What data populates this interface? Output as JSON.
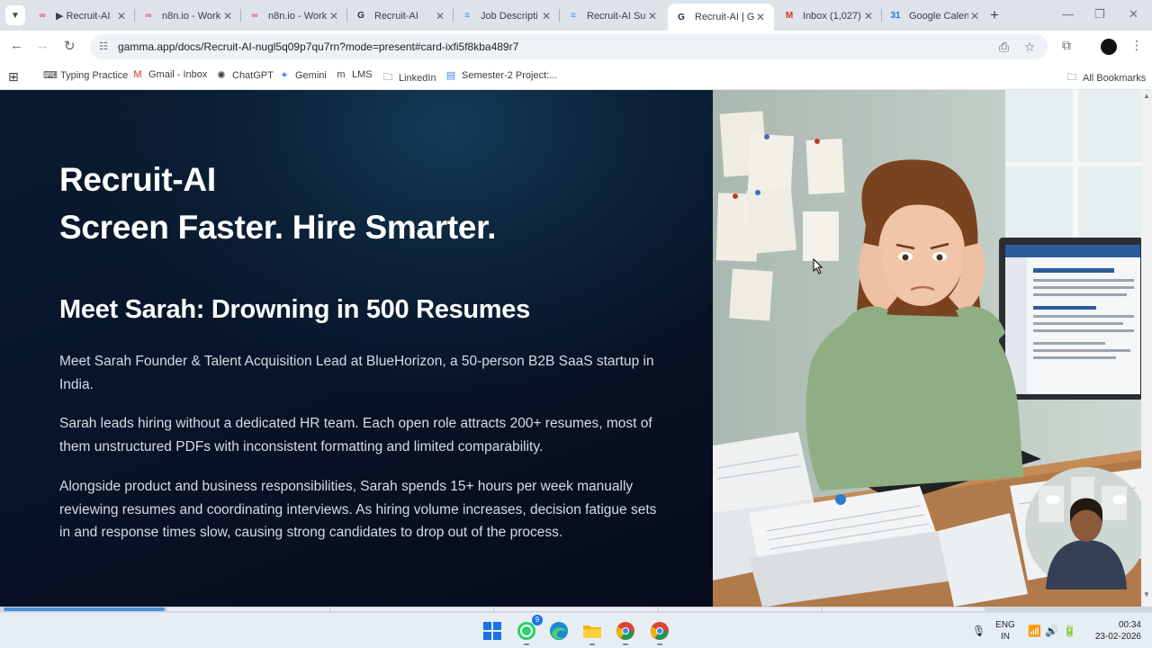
{
  "browser": {
    "tabs": [
      {
        "title": "▶ Recruit-AI",
        "favicon": "n8n-logo-icon",
        "fav_color": "#ea4b71",
        "active": false
      },
      {
        "title": "n8n.io - Work",
        "favicon": "n8n-logo-icon",
        "fav_color": "#ea4b71",
        "active": false
      },
      {
        "title": "n8n.io - Work",
        "favicon": "n8n-logo-icon",
        "fav_color": "#ea4b71",
        "active": false
      },
      {
        "title": "Recruit-AI",
        "favicon": "gamma-logo-icon",
        "fav_color": "#1f2a44",
        "active": false
      },
      {
        "title": "Job Descripti",
        "favicon": "google-docs-icon",
        "fav_color": "#4285f4",
        "active": false
      },
      {
        "title": "Recruit-AI Su",
        "favicon": "google-docs-icon",
        "fav_color": "#4285f4",
        "active": false
      },
      {
        "title": "Recruit-AI | G",
        "favicon": "gamma-logo-icon",
        "fav_color": "#1f2a44",
        "active": true
      },
      {
        "title": "Inbox (1,027)",
        "favicon": "gmail-icon",
        "fav_color": "#d93025",
        "active": false
      },
      {
        "title": "Google Calen",
        "favicon": "google-calendar-icon",
        "fav_color": "#1a73e8",
        "active": false
      }
    ],
    "url": "gamma.app/docs/Recruit-AI-nugl5q09p7qu7rn?mode=present#card-ixfi5f8kba489r7",
    "bookmarks": [
      {
        "label": "Typing Practice",
        "icon": "typing-practice-icon"
      },
      {
        "label": "Gmail - Inbox",
        "icon": "gmail-icon"
      },
      {
        "label": "ChatGPT",
        "icon": "chatgpt-icon"
      },
      {
        "label": "Gemini",
        "icon": "gemini-icon"
      },
      {
        "label": "LMS",
        "icon": "lms-icon"
      },
      {
        "label": "LinkedIn",
        "icon": "folder-icon"
      },
      {
        "label": "Semester-2 Project:...",
        "icon": "google-forms-icon"
      }
    ],
    "all_bookmarks_label": "All Bookmarks"
  },
  "slide": {
    "title_line1": "Recruit-AI",
    "title_line2": "Screen Faster. Hire Smarter.",
    "heading": "Meet Sarah: Drowning in 500 Resumes",
    "paragraphs": [
      "Meet Sarah Founder & Talent Acquisition Lead at BlueHorizon, a 50-person B2B SaaS startup in India.",
      "Sarah leads hiring without a dedicated HR team. Each open role attracts 200+ resumes, most of them unstructured PDFs with inconsistent formatting and limited comparability.",
      "Alongside product and business responsibilities, Sarah spends 15+ hours per week manually reviewing resumes and coordinating interviews. As hiring volume increases, decision fatigue sets in and response times slow, causing strong candidates to drop out of the process."
    ],
    "progress": 0.14
  },
  "taskbar": {
    "whatsapp_badge": "9",
    "language": "ENG",
    "region": "IN",
    "time": "00:34",
    "date": "23-02-2026"
  },
  "colors": {
    "accent": "#4a90d9",
    "slide_bg": "#08142a"
  }
}
